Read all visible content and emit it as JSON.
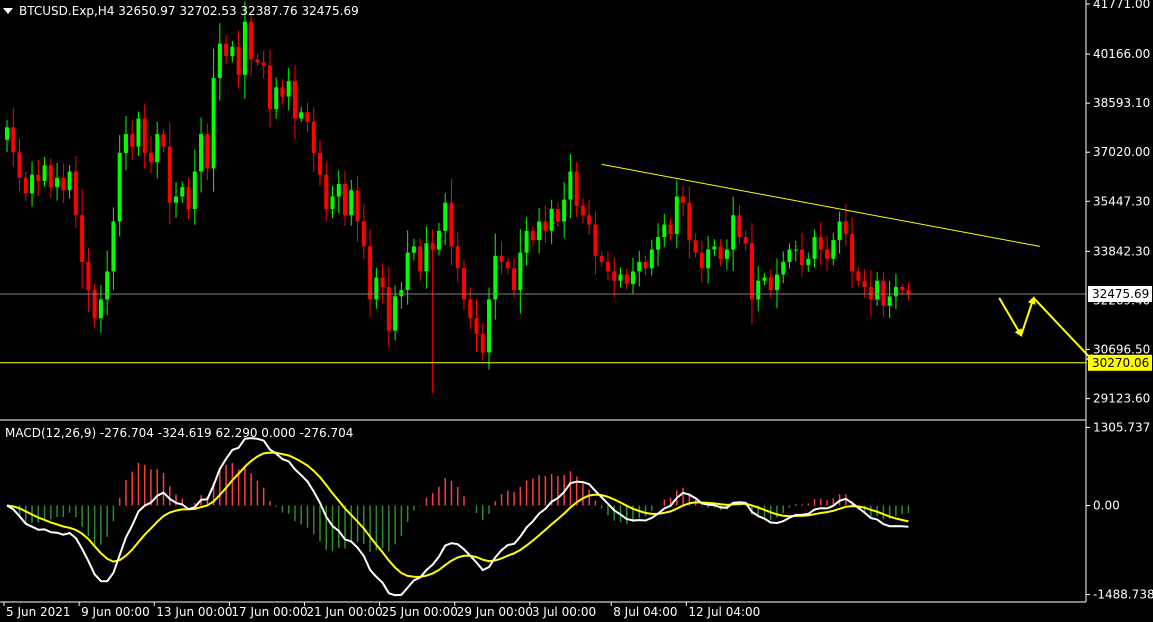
{
  "colors": {
    "background": "#000000",
    "bull": "#00ff00",
    "bear": "#ff0000",
    "macd_line": "#ffffff",
    "signal_line": "#ffff00",
    "hist_pos": "#ff3c3c",
    "hist_neg": "#2e8b2e",
    "trendline": "#ffff00",
    "bid_line": "#808080",
    "axis": "#ffffff",
    "text": "#ffffff",
    "level_label_bg": "#ffff00",
    "price_label_bg": "#ffffff"
  },
  "header": {
    "menu_icon": "triangle-down-icon",
    "symbol_text": "BTCUSD.Exp,H4  32650.97 32702.53 32387.76 32475.69"
  },
  "chart_data": [
    {
      "type": "candlestick",
      "symbol": "BTCUSD.Exp",
      "timeframe": "H4",
      "ohlc_last": {
        "open": 32650.97,
        "high": 32702.53,
        "low": 32387.76,
        "close": 32475.69
      },
      "ylim": [
        28500,
        41771.0
      ],
      "y_ticks": [
        "41771.00",
        "40166.00",
        "38593.10",
        "37020.00",
        "35447.30",
        "33842.30",
        "30696.50",
        "29123.60"
      ],
      "bid_price": 32475.69,
      "bid_label": "32475.69",
      "support_level": 30270.06,
      "support_label": "30270.06",
      "overlapped_tick": "32269.40",
      "trendline": {
        "from": {
          "t": 95.0,
          "price": 36630
        },
        "to": {
          "t": 165.0,
          "price": 34000
        }
      },
      "projection_arrows": [
        {
          "from": {
            "t": 158.5,
            "price": 32350
          },
          "to": {
            "t": 162.0,
            "price": 31150
          }
        },
        {
          "from": {
            "t": 162.0,
            "price": 31150
          },
          "to": {
            "t": 164.0,
            "price": 32350
          }
        },
        {
          "from": {
            "t": 164.0,
            "price": 32350
          },
          "to": {
            "t": 173.5,
            "price": 30330
          }
        }
      ],
      "closes": [
        37820,
        37020,
        36200,
        35700,
        36300,
        36100,
        36600,
        35900,
        36200,
        35800,
        36400,
        35000,
        33500,
        32600,
        31700,
        32300,
        33200,
        34800,
        37000,
        37600,
        37200,
        38100,
        37000,
        36700,
        37600,
        37200,
        35400,
        35600,
        35900,
        35200,
        36400,
        37600,
        36500,
        39400,
        40500,
        40100,
        40400,
        39500,
        41200,
        40000,
        39900,
        39800,
        38400,
        39100,
        38800,
        39300,
        38100,
        38300,
        38000,
        37000,
        36300,
        35200,
        35600,
        36000,
        35000,
        35800,
        34800,
        34000,
        32300,
        33000,
        32700,
        31300,
        32400,
        32600,
        33800,
        34000,
        33200,
        34100,
        33900,
        34500,
        35400,
        34000,
        33300,
        32300,
        31700,
        31200,
        30600,
        32300,
        33700,
        33500,
        33300,
        32600,
        33800,
        34500,
        34200,
        34800,
        34500,
        35200,
        34800,
        35500,
        36400,
        35300,
        35000,
        34700,
        33700,
        33500,
        33200,
        32900,
        33100,
        32800,
        33200,
        33500,
        33300,
        33900,
        34300,
        34700,
        34400,
        35600,
        35400,
        34200,
        33800,
        33300,
        33900,
        34000,
        33600,
        33900,
        35000,
        34300,
        34100,
        32300,
        32900,
        33000,
        32600,
        33100,
        33500,
        33900,
        33900,
        33400,
        33600,
        34300,
        33900,
        33600,
        34200,
        34800,
        34400,
        33200,
        32900,
        32700,
        32300,
        32900,
        32100,
        32400,
        32700,
        32600,
        32480
      ],
      "time_ticks": [
        {
          "t": 0,
          "label": "5 Jun 2021"
        },
        {
          "t": 12,
          "label": "9 Jun 00:00"
        },
        {
          "t": 24,
          "label": "13 Jun 00:00"
        },
        {
          "t": 36,
          "label": "17 Jun 00:00"
        },
        {
          "t": 48,
          "label": "21 Jun 00:00"
        },
        {
          "t": 60,
          "label": "25 Jun 00:00"
        },
        {
          "t": 72,
          "label": "29 Jun 00:00"
        },
        {
          "t": 84,
          "label": "3 Jul 00:00"
        },
        {
          "t": 97,
          "label": "8 Jul 04:00"
        },
        {
          "t": 109,
          "label": "12 Jul 04:00"
        }
      ]
    },
    {
      "type": "macd",
      "label": "MACD(12,26,9) -276.704 -324.619 62.290 0.000 -276.704",
      "params": [
        12,
        26,
        9
      ],
      "ylim": [
        -1580,
        1380
      ],
      "y_ticks": [
        "1305.737",
        "0.00",
        "-1488.738"
      ]
    }
  ]
}
